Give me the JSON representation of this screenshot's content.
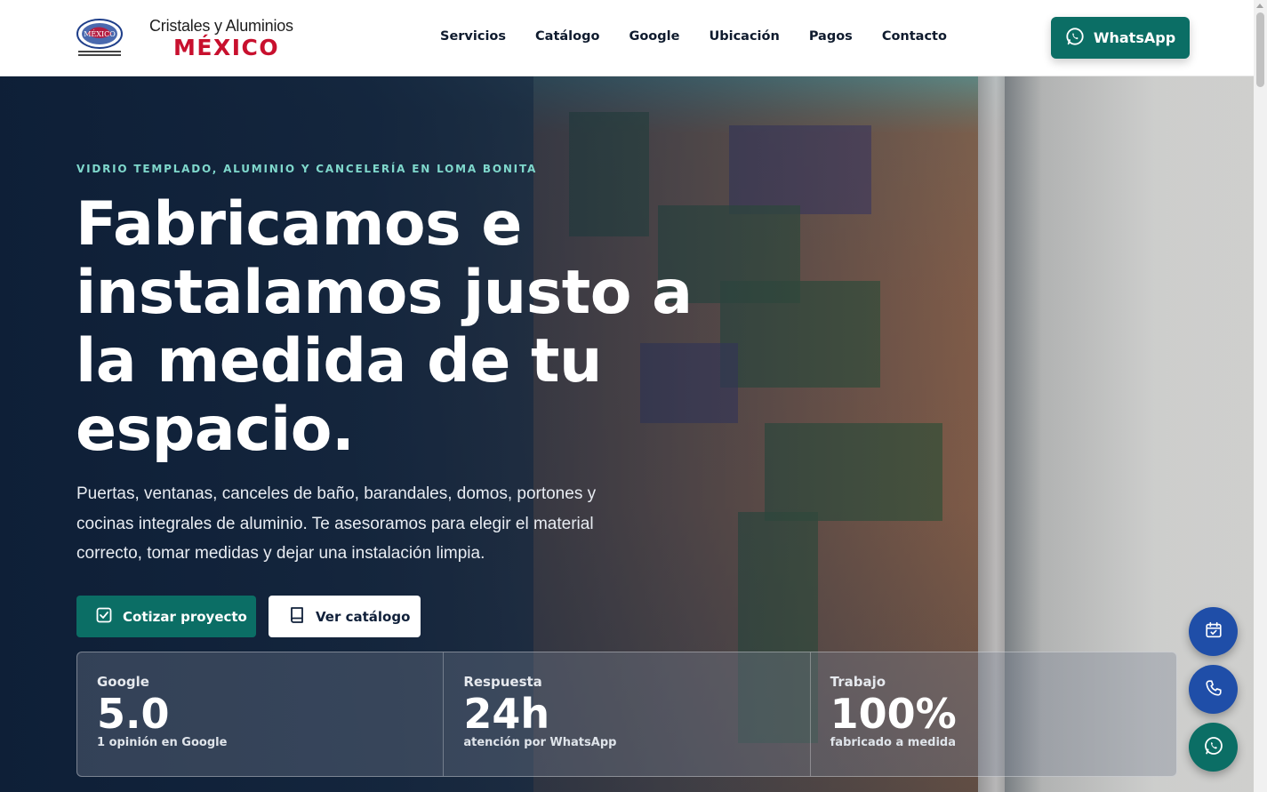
{
  "header": {
    "brand_line1": "Cristales y Aluminios",
    "brand_line2": "MÉXICO",
    "logo_text": "MÉXICO",
    "nav": [
      {
        "label": "Servicios"
      },
      {
        "label": "Catálogo"
      },
      {
        "label": "Google"
      },
      {
        "label": "Ubicación"
      },
      {
        "label": "Pagos"
      },
      {
        "label": "Contacto"
      }
    ],
    "whatsapp_label": "WhatsApp"
  },
  "hero": {
    "eyebrow": "VIDRIO TEMPLADO, ALUMINIO Y CANCELERÍA EN LOMA BONITA",
    "headline": "Fabricamos e instalamos justo a la medida de tu espacio.",
    "lede": "Puertas, ventanas, canceles de baño, barandales, domos, portones y cocinas integrales de aluminio. Te asesoramos para elegir el material correcto, tomar medidas y dejar una instalación limpia.",
    "primary_button": "Cotizar proyecto",
    "secondary_button": "Ver catálogo"
  },
  "stats": [
    {
      "label": "Google",
      "value": "5.0",
      "sub": "1 opinión en Google"
    },
    {
      "label": "Respuesta",
      "value": "24h",
      "sub": "atención por WhatsApp"
    },
    {
      "label": "Trabajo",
      "value": "100%",
      "sub": "fabricado a medida"
    }
  ],
  "colors": {
    "accent_green": "#0b6e65",
    "brand_red": "#c8102e",
    "fab_blue": "#1f4ea8",
    "eyebrow_teal": "#7fd8cc"
  },
  "icons": {
    "whatsapp": "whatsapp-icon",
    "calendar": "calendar-check-icon",
    "phone": "phone-icon",
    "checkbox": "checkbox-icon",
    "book": "book-icon"
  }
}
